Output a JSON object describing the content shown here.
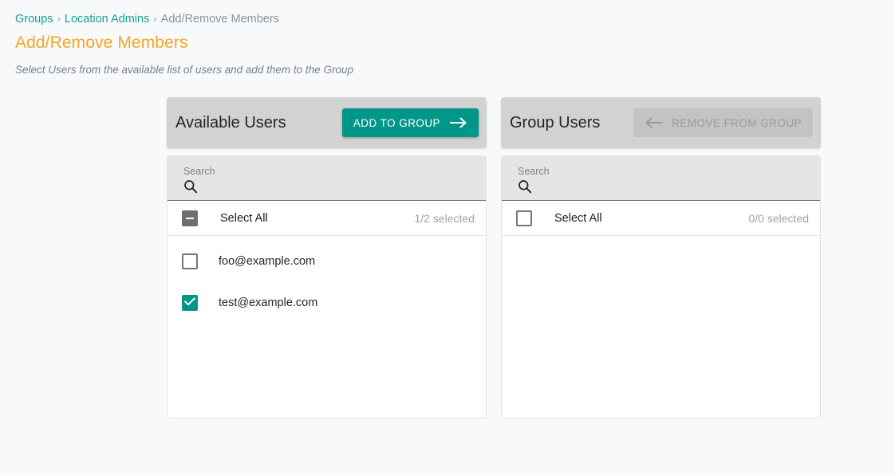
{
  "breadcrumb": {
    "items": [
      {
        "label": "Groups",
        "link": true
      },
      {
        "label": "Location Admins",
        "link": true
      },
      {
        "label": "Add/Remove Members",
        "link": false
      }
    ],
    "separator": "›"
  },
  "page": {
    "title": "Add/Remove Members",
    "subtitle": "Select Users from the available list of users and add them to the Group"
  },
  "colors": {
    "accent_teal": "#009688",
    "breadcrumb_link": "#1a9e96",
    "title_orange": "#f5a623",
    "panel_header_bg": "#d2d2d2",
    "search_bg": "#e5e5e5",
    "disabled_bg": "#c3c3c3",
    "disabled_text": "#9a9a9a",
    "page_bg": "#f7f9fb"
  },
  "available_panel": {
    "title": "Available Users",
    "action_label": "ADD TO GROUP",
    "action_icon": "arrow-right-icon",
    "action_disabled": false,
    "search": {
      "label": "Search",
      "value": "",
      "placeholder": "",
      "icon": "search-icon"
    },
    "select_all": {
      "label": "Select All",
      "state": "indeterminate",
      "count_text": "1/2 selected"
    },
    "users": [
      {
        "email": "foo@example.com",
        "checked": false
      },
      {
        "email": "test@example.com",
        "checked": true
      }
    ]
  },
  "group_panel": {
    "title": "Group Users",
    "action_label": "REMOVE FROM GROUP",
    "action_icon": "arrow-left-icon",
    "action_disabled": true,
    "search": {
      "label": "Search",
      "value": "",
      "placeholder": "",
      "icon": "search-icon"
    },
    "select_all": {
      "label": "Select All",
      "state": "unchecked",
      "count_text": "0/0 selected"
    },
    "users": []
  }
}
